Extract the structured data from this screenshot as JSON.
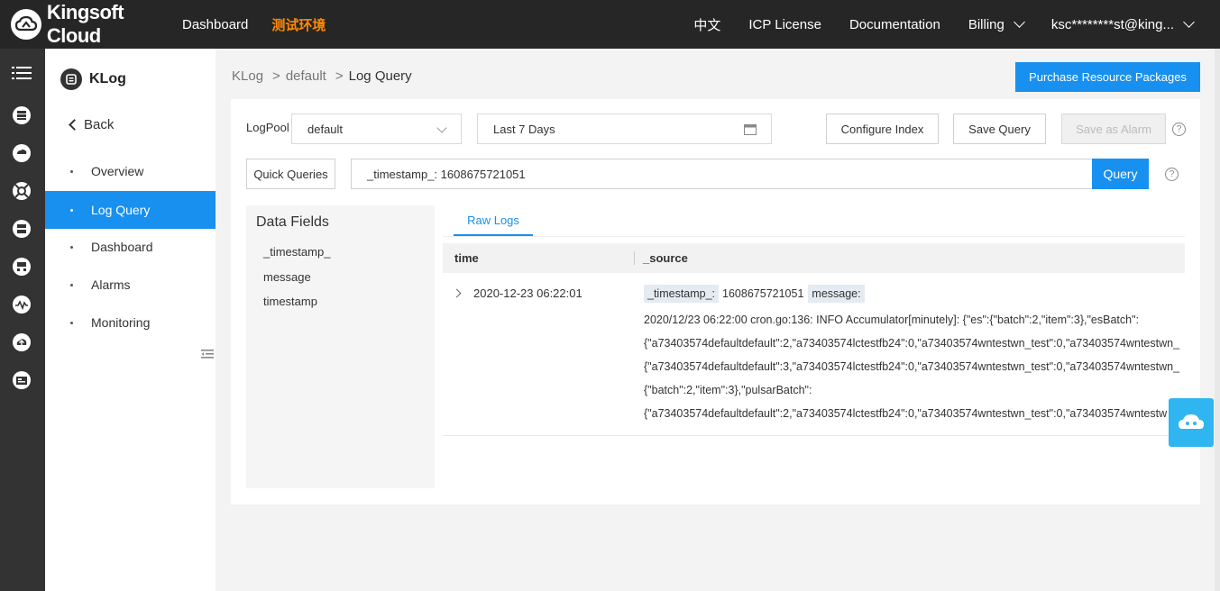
{
  "topbar": {
    "brand": "Kingsoft Cloud",
    "dashboard": "Dashboard",
    "env": "测试环境",
    "lang": "中文",
    "icp": "ICP License",
    "docs": "Documentation",
    "billing": "Billing",
    "user": "ksc********st@king..."
  },
  "nav": {
    "product": "KLog",
    "back": "Back",
    "items": [
      {
        "label": "Overview"
      },
      {
        "label": "Log Query"
      },
      {
        "label": "Dashboard"
      },
      {
        "label": "Alarms"
      },
      {
        "label": "Monitoring"
      }
    ]
  },
  "breadcrumb": {
    "root": "KLog",
    "sep1": ">",
    "mid": "default",
    "sep2": ">",
    "current": "Log Query"
  },
  "purchase_label": "Purchase Resource Packages",
  "query": {
    "logpool_label": "LogPool",
    "logpool_value": "default",
    "time_range": "Last 7 Days",
    "configure_index": "Configure Index",
    "save_query": "Save Query",
    "save_alarm": "Save as Alarm",
    "quick_queries": "Quick Queries",
    "query_text": "_timestamp_: 1608675721051",
    "query_button": "Query",
    "help_glyph": "?"
  },
  "data_fields": {
    "title": "Data Fields",
    "fields": [
      "_timestamp_",
      "message",
      "timestamp"
    ]
  },
  "logs": {
    "tab": "Raw Logs",
    "col_time": "time",
    "col_source": "_source",
    "rows": [
      {
        "time": "2020-12-23 06:22:01",
        "ts_key": "_timestamp_:",
        "ts_value": "1608675721051",
        "msg_key": "message:",
        "lines": [
          "2020/12/23 06:22:00 cron.go:136: INFO Accumulator[minutely]: {\"es\":{\"batch\":2,\"item\":3},\"esBatch\":",
          "{\"a73403574defaultdefault\":2,\"a73403574lctestfb24\":0,\"a73403574wntestwn_test\":0,\"a73403574wntestwn_",
          "{\"a73403574defaultdefault\":3,\"a73403574lctestfb24\":0,\"a73403574wntestwn_test\":0,\"a73403574wntestwn_",
          "{\"batch\":2,\"item\":3},\"pulsarBatch\":",
          "{\"a73403574defaultdefault\":2,\"a73403574lctestfb24\":0,\"a73403574wntestwn_test\":0,\"a73403574wntestw"
        ]
      }
    ]
  }
}
